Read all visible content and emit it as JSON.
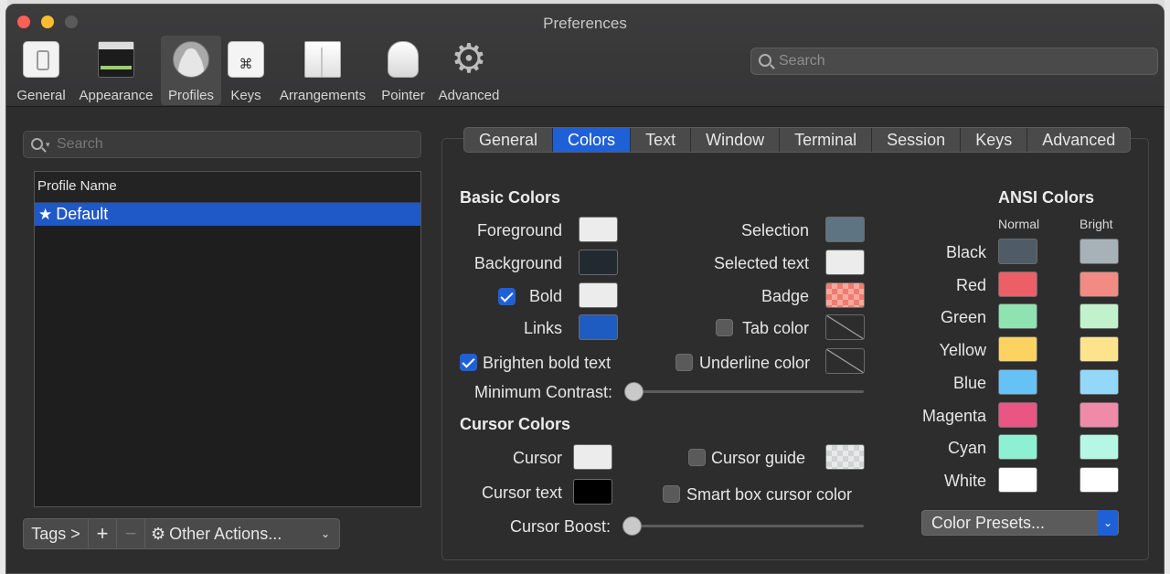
{
  "window": {
    "title": "Preferences"
  },
  "toolbar": {
    "items": [
      {
        "label": "General",
        "icon": "general-switch-icon"
      },
      {
        "label": "Appearance",
        "icon": "appearance-window-icon"
      },
      {
        "label": "Profiles",
        "icon": "profiles-person-icon",
        "active": true
      },
      {
        "label": "Keys",
        "icon": "keys-command-icon",
        "glyph": "⌘"
      },
      {
        "label": "Arrangements",
        "icon": "arrangements-window-icon"
      },
      {
        "label": "Pointer",
        "icon": "pointer-mouse-icon"
      },
      {
        "label": "Advanced",
        "icon": "advanced-gear-icon",
        "glyph": "⚙"
      }
    ],
    "search_placeholder": "Search"
  },
  "profiles": {
    "search_placeholder": "Search",
    "column_header": "Profile Name",
    "rows": [
      {
        "star": "★",
        "name": "Default",
        "selected": true
      }
    ],
    "bottom": {
      "tags": "Tags >",
      "add": "+",
      "remove": "−",
      "gear": "⚙",
      "other_actions": "Other Actions...",
      "dropdown_arrow": "⌄"
    }
  },
  "tabs": [
    "General",
    "Colors",
    "Text",
    "Window",
    "Terminal",
    "Session",
    "Keys",
    "Advanced"
  ],
  "active_tab": "Colors",
  "basic_colors": {
    "title": "Basic Colors",
    "left": [
      {
        "label": "Foreground",
        "color": "#ececec"
      },
      {
        "label": "Background",
        "color": "#232930"
      },
      {
        "label": "Bold",
        "color": "#ececec",
        "checkbox": true,
        "checked": true
      },
      {
        "label": "Links",
        "color": "#1f5cc1"
      }
    ],
    "right": [
      {
        "label": "Selection",
        "color": "#5f7482"
      },
      {
        "label": "Selected text",
        "color": "#ececec"
      },
      {
        "label": "Badge",
        "color": "#ee7c6f",
        "pattern": "checker"
      },
      {
        "label": "Tab color",
        "checkbox": true,
        "checked": false,
        "color": "none"
      }
    ],
    "brighten_bold": {
      "label": "Brighten bold text",
      "checked": true
    },
    "underline_color": {
      "label": "Underline color",
      "checked": false,
      "color": "none"
    },
    "min_contrast": {
      "label": "Minimum Contrast:",
      "value": 0
    }
  },
  "cursor_colors": {
    "title": "Cursor Colors",
    "cursor": {
      "label": "Cursor",
      "color": "#ececec"
    },
    "cursor_text": {
      "label": "Cursor text",
      "color": "#000000"
    },
    "cursor_guide": {
      "label": "Cursor guide",
      "checked": false,
      "color": "#e9e9e9",
      "pattern": "checker"
    },
    "smart_box": {
      "label": "Smart box cursor color",
      "checked": false
    },
    "cursor_boost": {
      "label": "Cursor Boost:",
      "value": 0
    }
  },
  "ansi": {
    "title": "ANSI Colors",
    "normal_header": "Normal",
    "bright_header": "Bright",
    "rows": [
      {
        "name": "Black",
        "normal": "#4f5b66",
        "bright": "#a7b2b8"
      },
      {
        "name": "Red",
        "normal": "#ec5f67",
        "bright": "#f18b83"
      },
      {
        "name": "Green",
        "normal": "#8fe3b0",
        "bright": "#c2f2cc"
      },
      {
        "name": "Yellow",
        "normal": "#fcd361",
        "bright": "#fde38c"
      },
      {
        "name": "Blue",
        "normal": "#66c2f5",
        "bright": "#93d8f8"
      },
      {
        "name": "Magenta",
        "normal": "#e95683",
        "bright": "#ef8aa8"
      },
      {
        "name": "Cyan",
        "normal": "#8ef0d3",
        "bright": "#b6f6e4"
      },
      {
        "name": "White",
        "normal": "#ffffff",
        "bright": "#ffffff"
      }
    ],
    "presets_label": "Color Presets...",
    "presets_arrow": "⌄"
  }
}
